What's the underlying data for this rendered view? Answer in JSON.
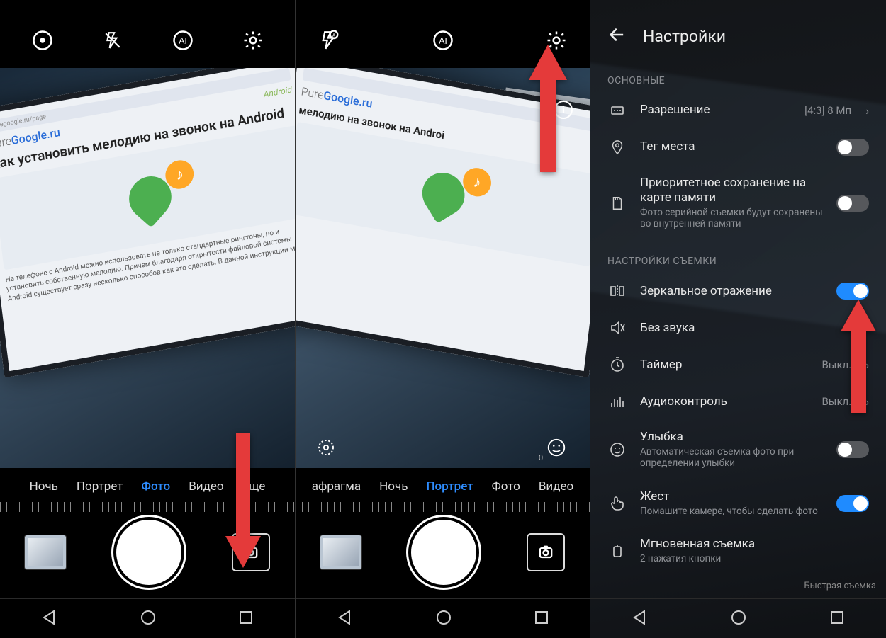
{
  "panel1": {
    "modes": [
      "Ночь",
      "Портрет",
      "Фото",
      "Видео",
      "Еще"
    ],
    "active_mode_index": 2,
    "viewfinder": {
      "browser_label": "puregoogle.ru/page",
      "site_brand_plain": "Pure",
      "site_brand_accent": "Google.ru",
      "tag": "Android",
      "headline": "Как установить мелодию на звонок на Android",
      "body": "На телефоне с Android можно использовать не только стандартные рингтоны, но и установить собственную мелодию. Причем благодаря открытости файловой системы Android существует сразу несколько способов как это сделать. В данной инструкции мы их"
    }
  },
  "panel2": {
    "modes": [
      "афрагма",
      "Ночь",
      "Портрет",
      "Фото",
      "Видео"
    ],
    "active_mode_index": 2,
    "beauty_count": "0"
  },
  "settings": {
    "title": "Настройки",
    "sections": {
      "basic": "ОСНОВНЫЕ",
      "shooting": "НАСТРОЙКИ СЪЕМКИ"
    },
    "rows": {
      "resolution": {
        "title": "Разрешение",
        "value": "[4:3] 8 Мп"
      },
      "geotag": {
        "title": "Тег места",
        "on": false
      },
      "sdcard": {
        "title": "Приоритетное сохранение на карте памяти",
        "subtitle": "Фото серийной съемки будут сохранены во внутренней памяти",
        "on": false
      },
      "mirror": {
        "title": "Зеркальное отражение",
        "on": true
      },
      "mute": {
        "title": "Без звука"
      },
      "timer": {
        "title": "Таймер",
        "value": "Выкл."
      },
      "audio": {
        "title": "Аудиоконтроль",
        "value": "Выкл."
      },
      "smile": {
        "title": "Улыбка",
        "subtitle": "Автоматическая съемка фото при определении улыбки",
        "on": false
      },
      "gesture": {
        "title": "Жест",
        "subtitle": "Помашите камере, чтобы сделать фото",
        "on": true
      },
      "instant": {
        "title": "Мгновенная съемка",
        "subtitle": "2 нажатия кнопки"
      }
    },
    "footer_badge": "Быстрая съемка"
  }
}
